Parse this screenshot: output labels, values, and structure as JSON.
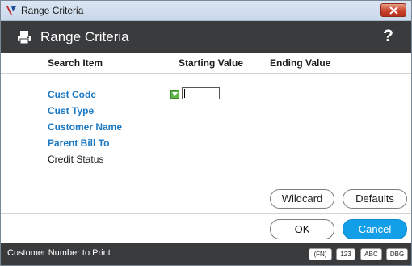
{
  "window": {
    "title": "Range Criteria"
  },
  "header": {
    "title": "Range Criteria",
    "help": "?"
  },
  "columns": {
    "search_item": "Search Item",
    "starting_value": "Starting Value",
    "ending_value": "Ending Value"
  },
  "rows": [
    {
      "label": "Cust Code",
      "style": "link"
    },
    {
      "label": "Cust Type",
      "style": "link"
    },
    {
      "label": "Customer Name",
      "style": "link"
    },
    {
      "label": "Parent Bill To",
      "style": "link"
    },
    {
      "label": "Credit Status",
      "style": "plain"
    }
  ],
  "active_field": {
    "starting_value": ""
  },
  "buttons": {
    "wildcard": "Wildcard",
    "defaults": "Defaults",
    "ok": "OK",
    "cancel": "Cancel"
  },
  "status": {
    "text": "Customer Number to Print",
    "badges": [
      "(FN)",
      "123",
      "ABC",
      "DBG"
    ]
  },
  "colors": {
    "accent": "#139fe8",
    "link": "#1b79c4",
    "header_bg": "#3a3b3d",
    "close_button": "#c8412b"
  },
  "icons": {
    "app": "app-logo-icon",
    "header": "printer-icon",
    "dropdown": "dropdown-arrow-icon",
    "close": "close-icon"
  }
}
